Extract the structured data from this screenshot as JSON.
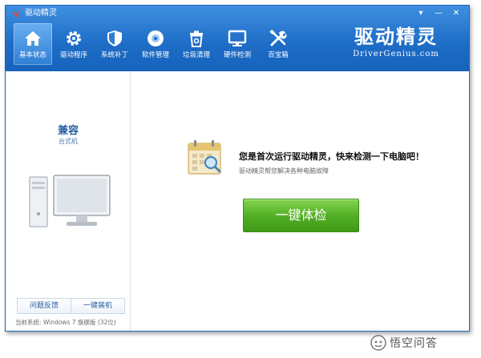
{
  "window": {
    "title": "驱动精灵",
    "controls": [
      "▾",
      "—",
      "✕"
    ]
  },
  "toolbar": {
    "items": [
      {
        "label": "基本状态",
        "icon": "home-icon",
        "active": true
      },
      {
        "label": "驱动程序",
        "icon": "gear-icon",
        "active": false
      },
      {
        "label": "系统补丁",
        "icon": "shield-icon",
        "active": false
      },
      {
        "label": "软件管理",
        "icon": "disc-icon",
        "active": false
      },
      {
        "label": "垃圾清理",
        "icon": "trash-icon",
        "active": false
      },
      {
        "label": "硬件检测",
        "icon": "monitor-icon",
        "active": false
      },
      {
        "label": "百宝箱",
        "icon": "tools-icon",
        "active": false
      }
    ]
  },
  "brand": {
    "name_cn": "驱动精灵",
    "name_en": "DriverGenius.com"
  },
  "sidebar": {
    "title": "兼容",
    "subtitle": "台式机",
    "feedback_label": "问题反馈",
    "install_label": "一键装机",
    "system_info": "当前系统: Windows 7 旗舰版 (32位)"
  },
  "main": {
    "headline": "您是首次运行驱动精灵，快来检测一下电脑吧！",
    "subline": "驱动精灵帮您解决各种电脑故障",
    "check_label": "一键体检"
  },
  "watermark": {
    "text": "悟空问答"
  },
  "colors": {
    "titlebar": "#1d6cc6",
    "accent_green": "#4fad22",
    "link_blue": "#1f5ba3"
  }
}
